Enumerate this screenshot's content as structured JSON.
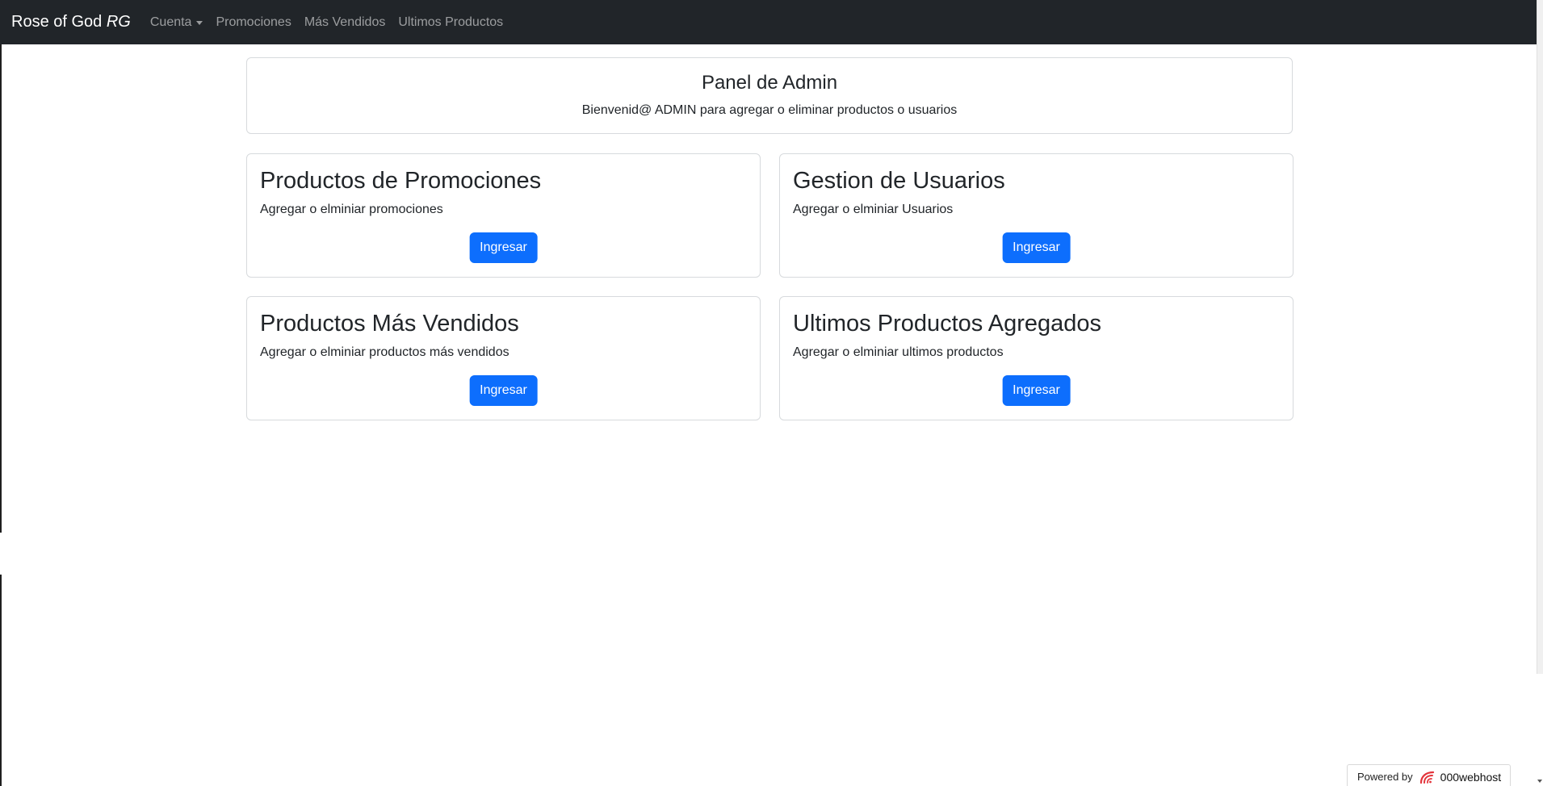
{
  "navbar": {
    "brand_main": "Rose of God",
    "brand_em": "RG",
    "links": [
      {
        "label": "Cuenta",
        "dropdown": true
      },
      {
        "label": "Promociones"
      },
      {
        "label": "Más Vendidos"
      },
      {
        "label": "Ultimos Productos"
      }
    ]
  },
  "header": {
    "title": "Panel de Admin",
    "subtitle": "Bienvenid@ ADMIN para agregar o eliminar productos o usuarios"
  },
  "cards": [
    {
      "title": "Productos de Promociones",
      "text": "Agregar o elminiar promociones",
      "button": "Ingresar"
    },
    {
      "title": "Gestion de Usuarios",
      "text": "Agregar o elminiar Usuarios",
      "button": "Ingresar"
    },
    {
      "title": "Productos Más Vendidos",
      "text": "Agregar o elminiar productos más vendidos",
      "button": "Ingresar"
    },
    {
      "title": "Ultimos Productos Agregados",
      "text": "Agregar o elminiar ultimos productos",
      "button": "Ingresar"
    }
  ],
  "footer_badge": {
    "powered_by": "Powered by",
    "brand": "000webhost",
    "icon": "000webhost-logo-icon"
  },
  "colors": {
    "navbar_bg": "#212529",
    "primary_button": "#0d6efd",
    "badge_logo": "#e3343b"
  }
}
